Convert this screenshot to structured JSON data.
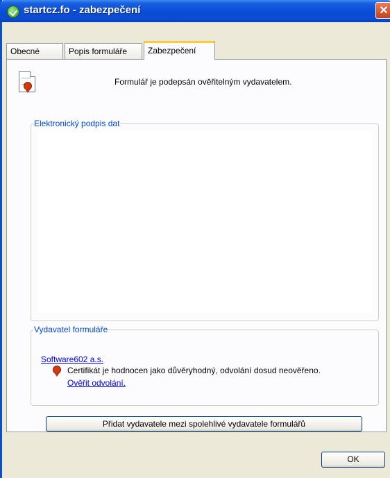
{
  "window": {
    "title": "startcz.fo - zabezpečení",
    "close_glyph": "✕"
  },
  "tabs": [
    {
      "label": "Obecné"
    },
    {
      "label": "Popis formuláře"
    },
    {
      "label": "Zabezpečení",
      "active": true
    }
  ],
  "security": {
    "status_text": "Formulář je podepsán ověřitelným vydavatelem.",
    "status_icon": "signed-document-icon"
  },
  "signature_group": {
    "label": "Elektronický podpis dat"
  },
  "publisher_group": {
    "label": "Vydavatel formuláře",
    "publisher_link": "Software602 a.s.",
    "cert_text": "Certifikát je hodnocen jako důvěryhodný, odvolání dosud neověřeno.",
    "verify_link": "Ověřit odvolání."
  },
  "buttons": {
    "add_trusted": "Přidat vydavatele mezi spolehlivé vydavatele formulářů",
    "ok": "OK"
  },
  "colors": {
    "titlebar": "#0a4ed8",
    "group_label": "#0046d5",
    "tab_highlight": "#ffc83c"
  }
}
